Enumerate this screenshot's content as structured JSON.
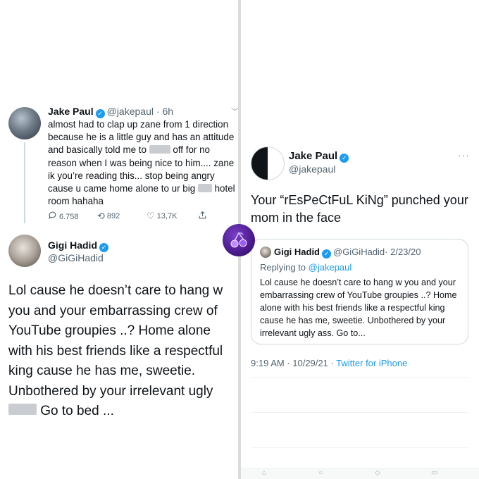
{
  "left_panel": {
    "jake_tweet": {
      "name": "Jake Paul",
      "handle": "@jakepaul",
      "time": "6h",
      "text_parts": [
        "almost had to clap up zane from 1 direction because he is a little guy and has an attitude and basically told me to ",
        " off for no reason when I was being nice to him.... zane ik you’re reading this... stop being angry cause u came home alone to ur big ",
        " hotel room hahaha"
      ],
      "stats": {
        "replies": "6.758",
        "retweets": "892",
        "likes": "13,7K"
      }
    },
    "gigi_tweet": {
      "name": "Gigi Hadid",
      "handle": "@GiGiHadid",
      "text_before": "Lol cause he doesn’t care to hang w you and your embarrassing crew of YouTube groupies ..? Home alone with his best friends like a respectful king cause he has me, sweetie. Unbothered by your irrelevant ugly ",
      "text_after": " Go to bed ..."
    }
  },
  "right_panel": {
    "name": "Jake Paul",
    "handle": "@jakepaul",
    "more": "···",
    "text": "Your “rEsPeCtFuL KiNg” punched your mom in the face",
    "quote": {
      "name": "Gigi Hadid",
      "handle": "@GiGiHadid",
      "date": "· 2/23/20",
      "replying_prefix": "Replying to ",
      "replying_to": "@jakepaul",
      "text": "Lol cause he doesn’t care to hang w you and your embarrassing crew of YouTube groupies ..? Home alone with his best friends like a respectful king cause he has me, sweetie. Unbothered by your irrelevant ugly ass. Go to..."
    },
    "meta_time": "9:19 AM · 10/29/21 · ",
    "meta_source": "Twitter for iPhone"
  },
  "icons": {
    "verified": "verified-badge-icon",
    "reply": "reply-icon",
    "retweet": "retweet-icon",
    "like": "heart-icon",
    "share": "share-icon",
    "logo": "cherry-logo-icon"
  },
  "colors": {
    "verified": "#1d9bf0",
    "link": "#1d9bf0",
    "secondary_text": "#536471",
    "primary_text": "#0f1419",
    "logo_purple": "#4a1a8c"
  }
}
